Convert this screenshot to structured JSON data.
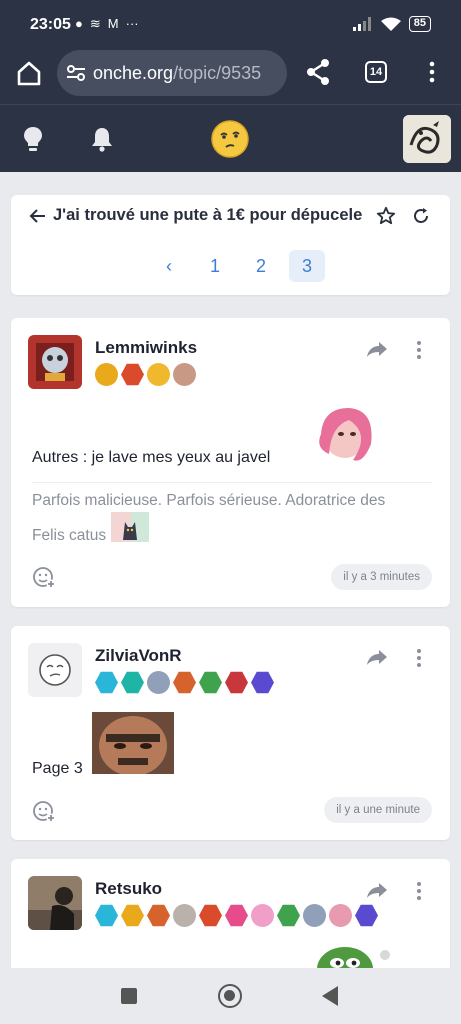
{
  "status_bar": {
    "time": "23:05",
    "battery": "85"
  },
  "browser": {
    "url_host": "onche.org",
    "url_path": "/topic/9535",
    "tab_count": "14"
  },
  "topic": {
    "title": "J'ai trouvé une pute à 1€ pour dépucele",
    "pages": [
      "1",
      "2",
      "3"
    ],
    "prev_label": "‹",
    "current_page": "3"
  },
  "posts": [
    {
      "username": "Lemmiwinks",
      "content": "Autres : je lave mes yeux au javel",
      "signature_line1": "Parfois malicieuse. Parfois sérieuse. Adoratrice des",
      "signature_line2": "Felis catus",
      "time": "il y a 3 minutes",
      "badge_colors": [
        "#e8a91a",
        "#d94b2b",
        "#f0b92d",
        "#c89a86"
      ]
    },
    {
      "username": "ZilviaVonR",
      "content": "Page 3",
      "time": "il y a une minute",
      "badge_colors": [
        "#29b6d9",
        "#1fb5a6",
        "#8fa0b8",
        "#d6622c",
        "#3fa34d",
        "#c8373b",
        "#5a4ad0"
      ]
    },
    {
      "username": "Retsuko",
      "badge_colors": [
        "#29b6d9",
        "#e8a91a",
        "#d6622c",
        "#b9b1aa",
        "#d94b2b",
        "#e64b8b",
        "#f0a0c8",
        "#3fa34d",
        "#8fa0b8",
        "#e89bb0",
        "#5a4ad0"
      ]
    }
  ],
  "colors": {
    "header_bg": "#2c3345",
    "page_bg": "#e9eaee",
    "link_blue": "#3b7ed8"
  }
}
